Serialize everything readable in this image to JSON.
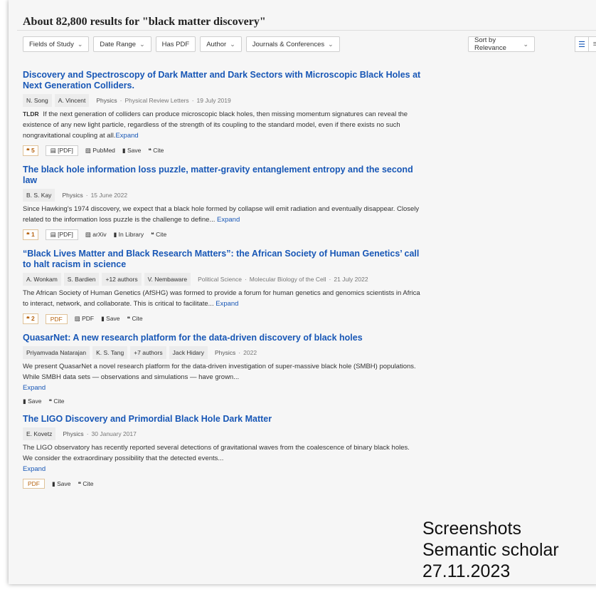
{
  "results_count_title": "About 82,800 results for \"black matter discovery\"",
  "filters": [
    {
      "label": "Fields of Study",
      "has_dropdown": true
    },
    {
      "label": "Date Range",
      "has_dropdown": true
    },
    {
      "label": "Has PDF",
      "has_dropdown": false
    },
    {
      "label": "Author",
      "has_dropdown": true
    },
    {
      "label": "Journals & Conferences",
      "has_dropdown": true
    }
  ],
  "sort": {
    "label": "Sort by Relevance"
  },
  "view_icons": [
    "list-view-icon",
    "compact-view-icon"
  ],
  "papers": [
    {
      "title": "Discovery and Spectroscopy of Dark Matter and Dark Sectors with Microscopic Black Holes at Next Generation Colliders.",
      "authors": [
        "N. Song",
        "A. Vincent"
      ],
      "field": "Physics",
      "venue": "Physical Review Letters",
      "date": "19 July 2019",
      "tldr": "TLDR",
      "abstract": "If the next generation of colliders can produce microscopic black holes, then missing momentum signatures can reveal the existence of any new light particle, regardless of the strength of its coupling to the standard model, even if there exists no such nongravitational coupling at all.",
      "expand": "Expand",
      "citations": "5",
      "pdf": "[PDF]",
      "source": "PubMed",
      "save": "Save",
      "cite": "Cite"
    },
    {
      "title": "The black hole information loss puzzle, matter-gravity entanglement entropy and the second law",
      "authors": [
        "B. S. Kay"
      ],
      "field": "Physics",
      "date": "15 June 2022",
      "abstract": "Since Hawking's 1974 discovery, we expect that a black hole formed by collapse will emit radiation and eventually disappear. Closely related to the information loss puzzle is the challenge to define...",
      "expand": "Expand",
      "citations": "1",
      "pdf": "[PDF]",
      "source": "arXiv",
      "save": "In Library",
      "cite": "Cite"
    },
    {
      "title": "“Black Lives Matter and Black Research Matters”: the African Society of Human Genetics’ call to halt racism in science",
      "authors": [
        "A. Wonkam",
        "S. Bardien",
        "+12 authors",
        "V. Nembaware"
      ],
      "field": "Political Science",
      "venue": "Molecular Biology of the Cell",
      "date": "21 July 2022",
      "abstract": "The African Society of Human Genetics (AfSHG) was formed to provide a forum for human genetics and genomics scientists in Africa to interact, network, and collaborate. This is critical to facilitate...",
      "expand": "Expand",
      "citations": "2",
      "pdf": "PDF",
      "source": "PDF",
      "save": "Save",
      "cite": "Cite"
    },
    {
      "title": "QuasarNet: A new research platform for the data-driven discovery of black holes",
      "authors": [
        "Priyamvada Natarajan",
        "K. S. Tang",
        "+7 authors",
        "Jack Hidary"
      ],
      "field": "Physics",
      "date": "2022",
      "abstract": "We present QuasarNet a novel research platform for the data-driven investigation of super-massive black hole (SMBH) populations. While SMBH data sets — observations and simulations — have grown...",
      "expand": "Expand",
      "save": "Save",
      "cite": "Cite"
    },
    {
      "title": "The LIGO Discovery and Primordial Black Hole Dark Matter",
      "authors": [
        "E. Kovetz"
      ],
      "field": "Physics",
      "date": "30 January 2017",
      "abstract": "The LIGO observatory has recently reported several detections of gravitational waves from the coalescence of binary black holes. We consider the extraordinary possibility that the detected events...",
      "expand": "Expand",
      "pdf": "PDF",
      "save": "Save",
      "cite": "Cite"
    }
  ],
  "watermark": [
    "Screenshots",
    "Semantic scholar",
    "27.11.2023"
  ]
}
